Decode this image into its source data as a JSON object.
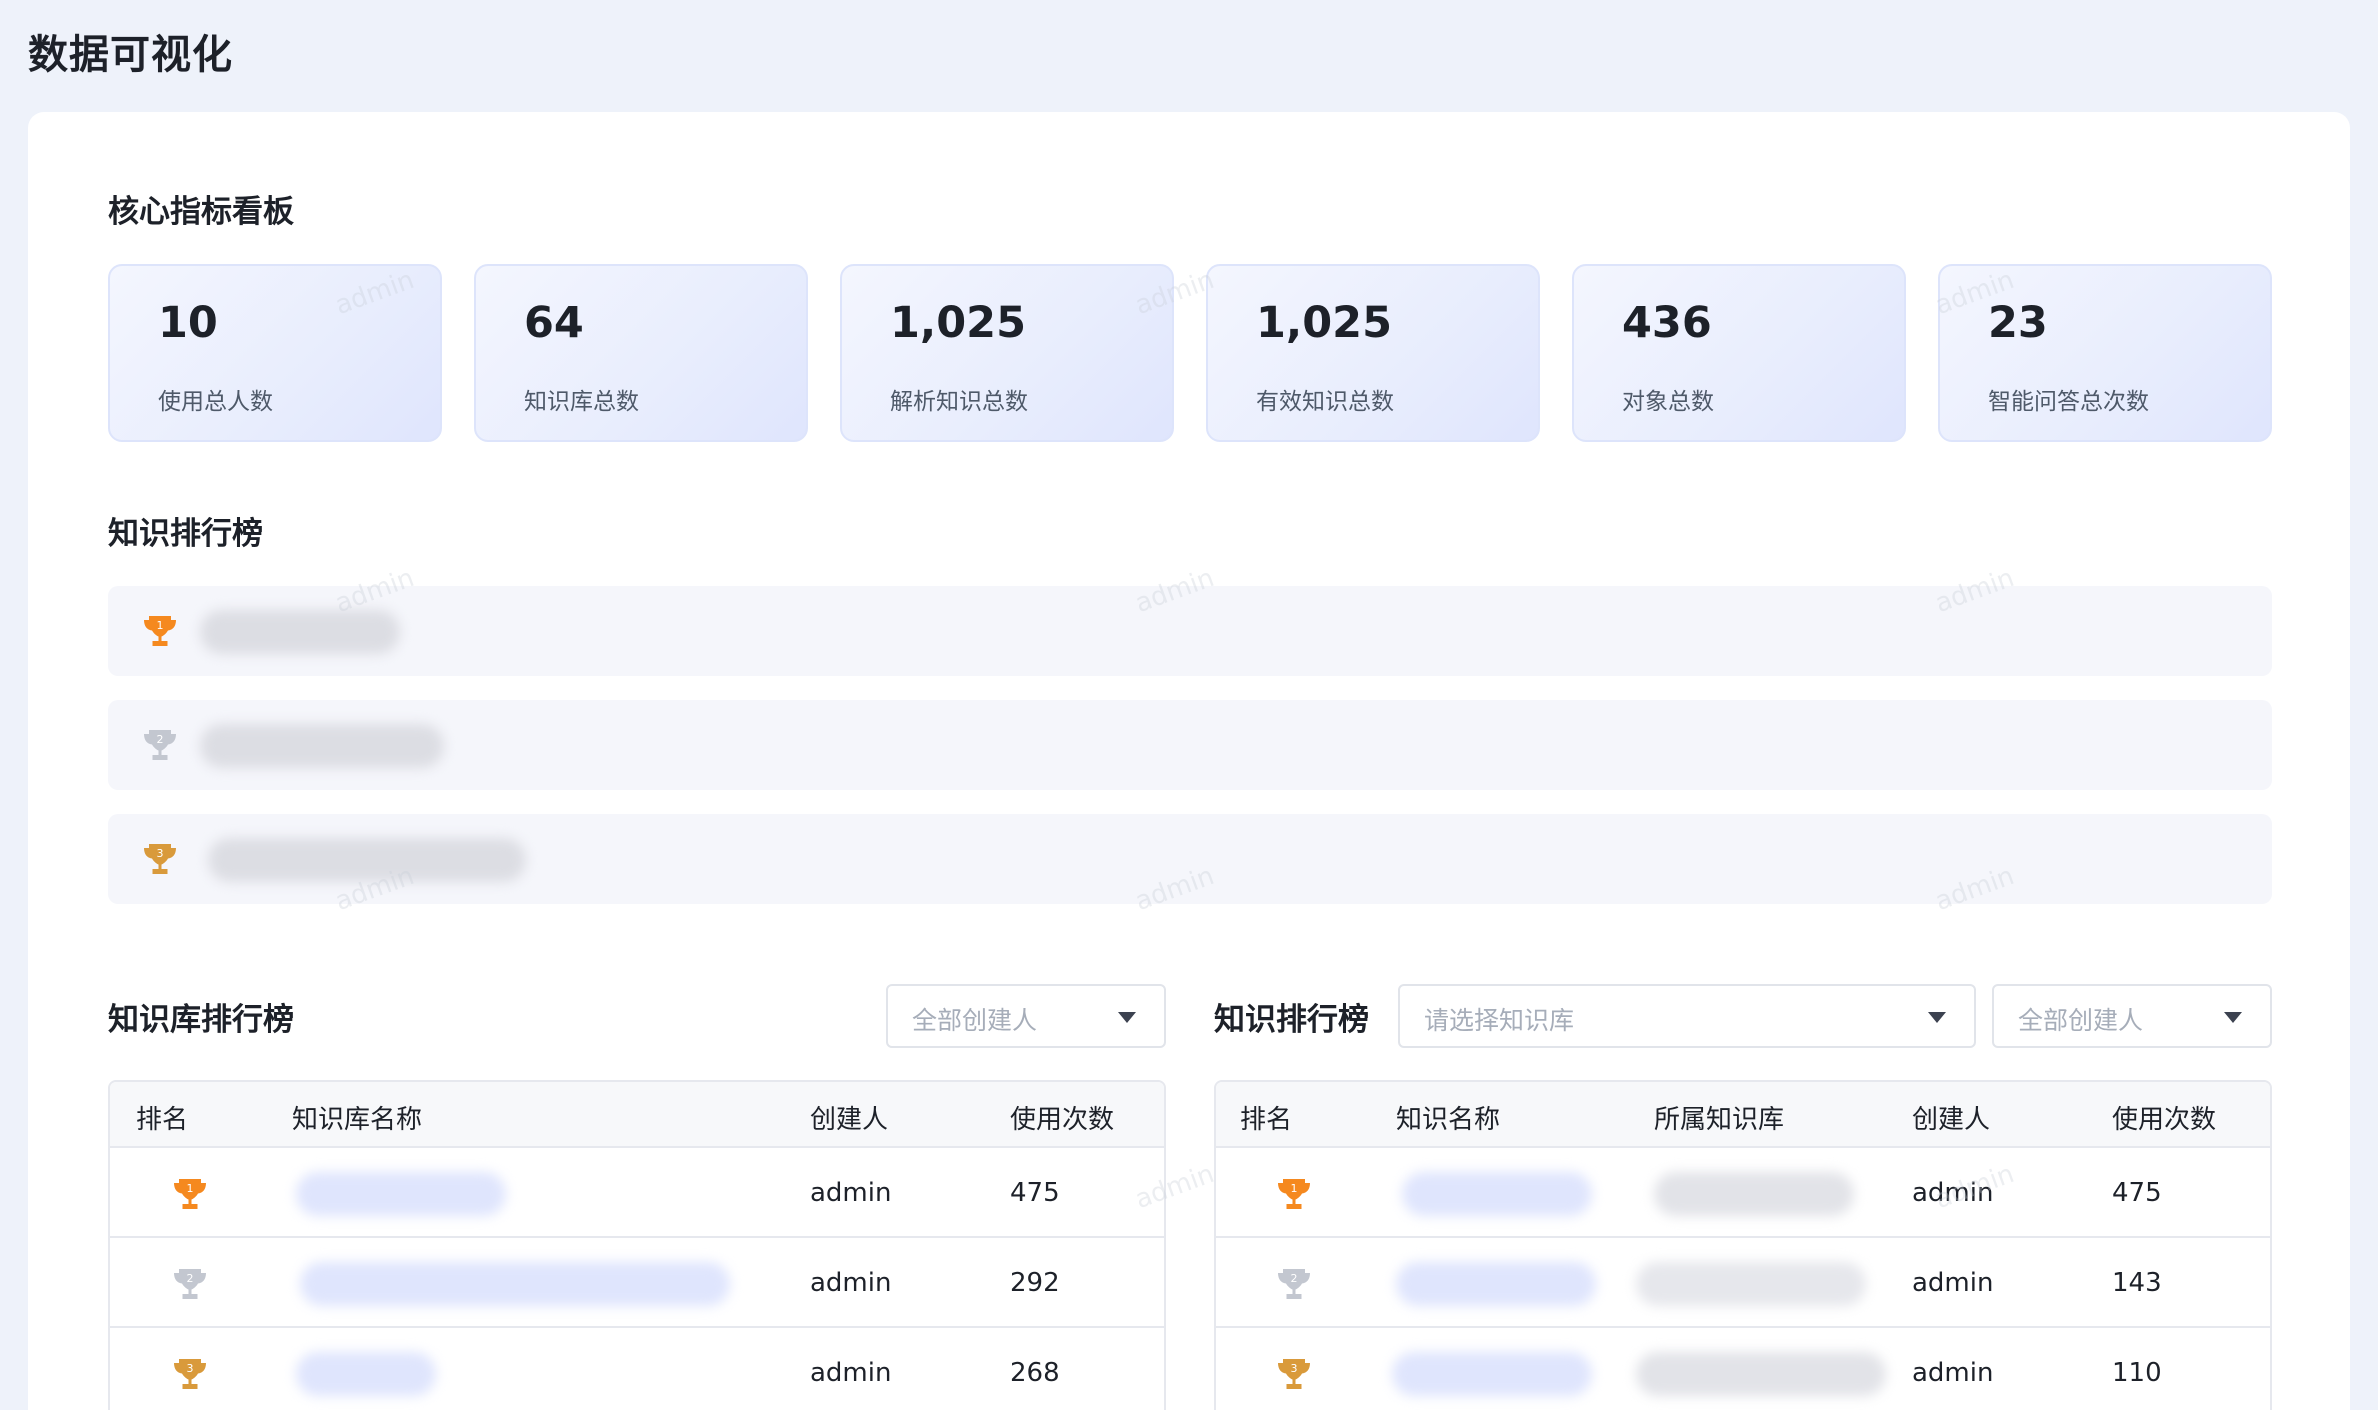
{
  "page_title": "数据可视化",
  "core_metrics": {
    "title": "核心指标看板",
    "cards": [
      {
        "value": "10",
        "label": "使用总人数"
      },
      {
        "value": "64",
        "label": "知识库总数"
      },
      {
        "value": "1,025",
        "label": "解析知识总数"
      },
      {
        "value": "1,025",
        "label": "有效知识总数"
      },
      {
        "value": "436",
        "label": "对象总数"
      },
      {
        "value": "23",
        "label": "智能问答总次数"
      }
    ]
  },
  "knowledge_top": {
    "title": "知识排行榜",
    "ranks": [
      {
        "rank": "1"
      },
      {
        "rank": "2"
      },
      {
        "rank": "3"
      }
    ]
  },
  "kb_ranking": {
    "title": "知识库排行榜",
    "creator_select": {
      "placeholder": "全部创建人"
    },
    "headers": [
      "排名",
      "知识库名称",
      "创建人",
      "使用次数"
    ],
    "rows": [
      {
        "rank": "1",
        "creator": "admin",
        "count": "475"
      },
      {
        "rank": "2",
        "creator": "admin",
        "count": "292"
      },
      {
        "rank": "3",
        "creator": "admin",
        "count": "268"
      }
    ]
  },
  "k_ranking": {
    "title": "知识排行榜",
    "kb_select": {
      "placeholder": "请选择知识库"
    },
    "creator_select": {
      "placeholder": "全部创建人"
    },
    "headers": [
      "排名",
      "知识名称",
      "所属知识库",
      "创建人",
      "使用次数"
    ],
    "rows": [
      {
        "rank": "1",
        "creator": "admin",
        "count": "475"
      },
      {
        "rank": "2",
        "creator": "admin",
        "count": "143"
      },
      {
        "rank": "3",
        "creator": "admin",
        "count": "110"
      }
    ]
  },
  "watermark": "admin",
  "colors": {
    "gold": "#f5891f",
    "silver": "#b9bec8",
    "bronze": "#d99a3b",
    "blur_blue": "#dfe5fd",
    "blur_gray": "#e6e7ec"
  }
}
